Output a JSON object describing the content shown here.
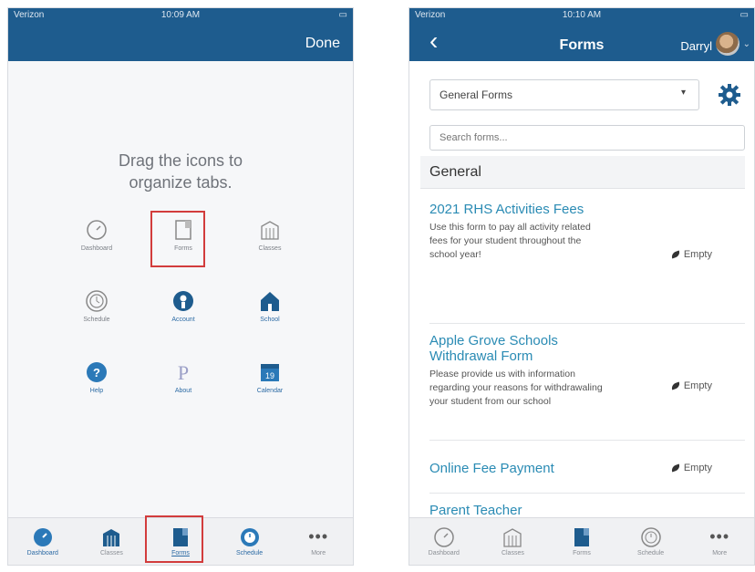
{
  "left": {
    "status": {
      "carrier": "Verizon",
      "time": "10:09 AM"
    },
    "done_label": "Done",
    "instruction_line1": "Drag the icons to",
    "instruction_line2": "organize tabs.",
    "grid": [
      {
        "label": "Dashboard",
        "icon": "dashboard-icon"
      },
      {
        "label": "Forms",
        "icon": "forms-icon"
      },
      {
        "label": "Classes",
        "icon": "classes-icon"
      },
      {
        "label": "Schedule",
        "icon": "schedule-icon"
      },
      {
        "label": "Account",
        "icon": "account-icon"
      },
      {
        "label": "School",
        "icon": "school-icon"
      },
      {
        "label": "Help",
        "icon": "help-icon"
      },
      {
        "label": "About",
        "icon": "about-icon"
      },
      {
        "label": "Calendar",
        "icon": "calendar-icon",
        "day": "19"
      }
    ],
    "tabs": [
      {
        "label": "Dashboard",
        "icon": "dashboard-icon"
      },
      {
        "label": "Classes",
        "icon": "classes-icon"
      },
      {
        "label": "Forms",
        "icon": "forms-icon"
      },
      {
        "label": "Schedule",
        "icon": "schedule-icon"
      },
      {
        "label": "More",
        "icon": "more-icon"
      }
    ]
  },
  "right": {
    "status": {
      "carrier": "Verizon",
      "time": "10:10 AM"
    },
    "title": "Forms",
    "user_name": "Darryl",
    "select_value": "General Forms",
    "search_placeholder": "Search forms...",
    "section": "General",
    "forms": [
      {
        "title": "2021 RHS Activities Fees",
        "description": "Use this form to pay all activity related fees for your student throughout the school year!",
        "status": "Empty"
      },
      {
        "title": "Apple Grove Schools Withdrawal Form",
        "description": "Please provide us with information regarding your reasons for withdrawaling your student from our school",
        "status": "Empty"
      },
      {
        "title": "Online Fee Payment",
        "description": "",
        "status": "Empty"
      },
      {
        "title": "Parent Teacher",
        "description": "",
        "status": ""
      }
    ],
    "tabs": [
      {
        "label": "Dashboard",
        "icon": "dashboard-icon"
      },
      {
        "label": "Classes",
        "icon": "classes-icon"
      },
      {
        "label": "Forms",
        "icon": "forms-icon"
      },
      {
        "label": "Schedule",
        "icon": "schedule-icon"
      },
      {
        "label": "More",
        "icon": "more-icon"
      }
    ]
  },
  "colors": {
    "nav_blue": "#1e5c8e",
    "link_blue": "#2a8bb4",
    "highlight_red": "#d23c3c"
  }
}
